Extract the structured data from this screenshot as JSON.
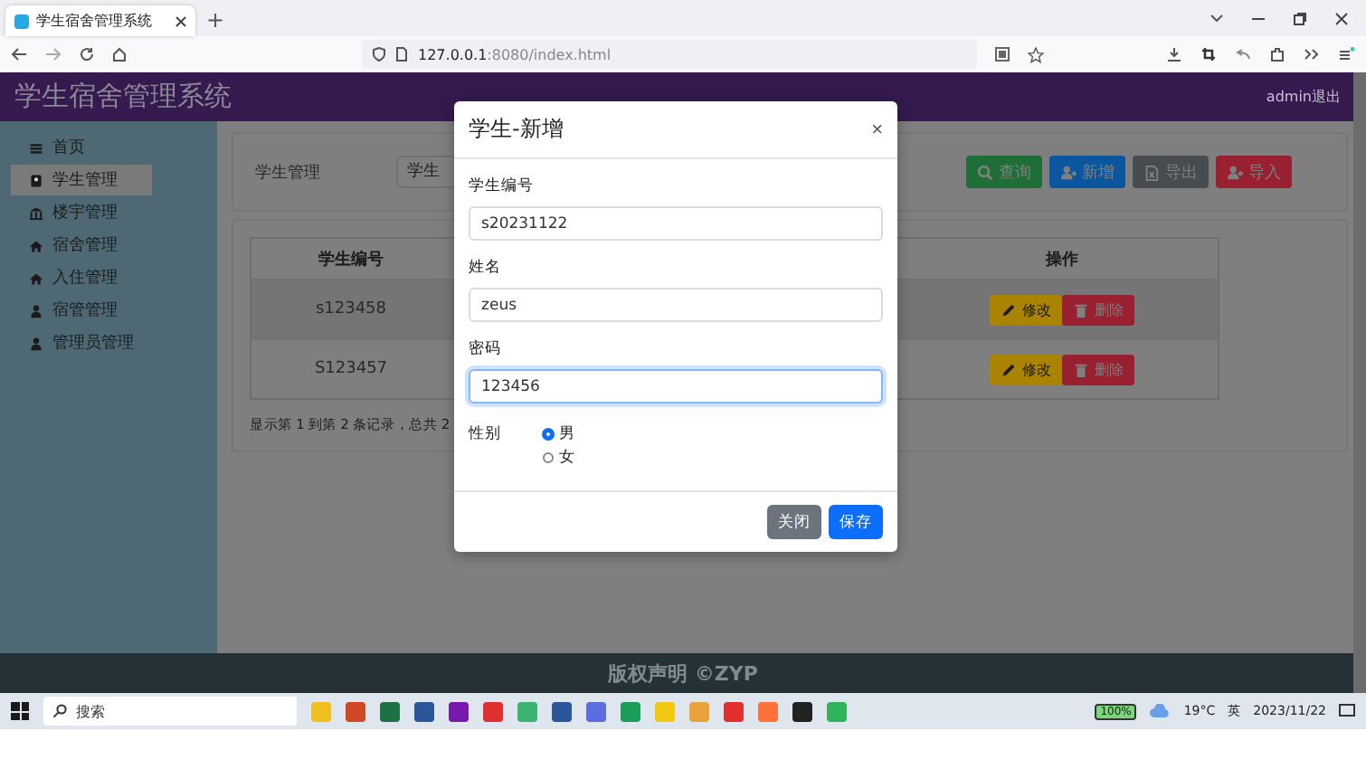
{
  "browser": {
    "tab_title": "学生宿舍管理系统",
    "new_tab": "+",
    "url_host": "127.0.0.1",
    "url_path": ":8080/index.html"
  },
  "header": {
    "title": "学生宿舍管理系统",
    "user": "admin退出"
  },
  "sidebar": {
    "items": [
      {
        "label": "首页",
        "kind": "menu",
        "selected": false
      },
      {
        "label": "学生管理",
        "kind": "badge",
        "selected": true
      },
      {
        "label": "楼宇管理",
        "kind": "bank",
        "selected": false
      },
      {
        "label": "宿舍管理",
        "kind": "home",
        "selected": false
      },
      {
        "label": "入住管理",
        "kind": "home",
        "selected": false
      },
      {
        "label": "宿管管理",
        "kind": "user",
        "selected": false
      },
      {
        "label": "管理员管理",
        "kind": "user",
        "selected": false
      }
    ]
  },
  "search": {
    "label": "学生管理",
    "placeholder": "学生",
    "buttons": [
      {
        "label": "查询",
        "kind": "search"
      },
      {
        "label": "新增",
        "kind": "add"
      },
      {
        "label": "导出",
        "kind": "export"
      },
      {
        "label": "导入",
        "kind": "import"
      }
    ]
  },
  "table": {
    "columns": [
      "学生编号",
      "操作"
    ],
    "rows": [
      {
        "student_id": "s123458",
        "actions": [
          {
            "label": "修改",
            "kind": "edit"
          },
          {
            "label": "删除",
            "kind": "delete"
          }
        ]
      },
      {
        "student_id": "S123457",
        "actions": [
          {
            "label": "修改",
            "kind": "edit"
          },
          {
            "label": "删除",
            "kind": "delete"
          }
        ]
      }
    ],
    "pagination": "显示第 1 到第 2 条记录，总共 2"
  },
  "footer": "版权声明 ©ZYP",
  "modal": {
    "title": "学生-新增",
    "close": "×",
    "fields": [
      {
        "label": "学生编号",
        "value": "s20231122",
        "focused": false
      },
      {
        "label": "姓名",
        "value": "zeus",
        "focused": false
      },
      {
        "label": "密码",
        "value": "123456",
        "focused": true
      }
    ],
    "gender": {
      "label": "性别",
      "options": [
        {
          "label": "男",
          "selected": true
        },
        {
          "label": "女",
          "selected": false
        }
      ]
    },
    "buttons": [
      {
        "label": "关闭",
        "kind": "secondary"
      },
      {
        "label": "保存",
        "kind": "primary"
      }
    ]
  },
  "taskbar": {
    "search_placeholder": "搜索",
    "battery": "100%",
    "weather": "19°C",
    "ime": "英",
    "date": "2023/11/22"
  }
}
